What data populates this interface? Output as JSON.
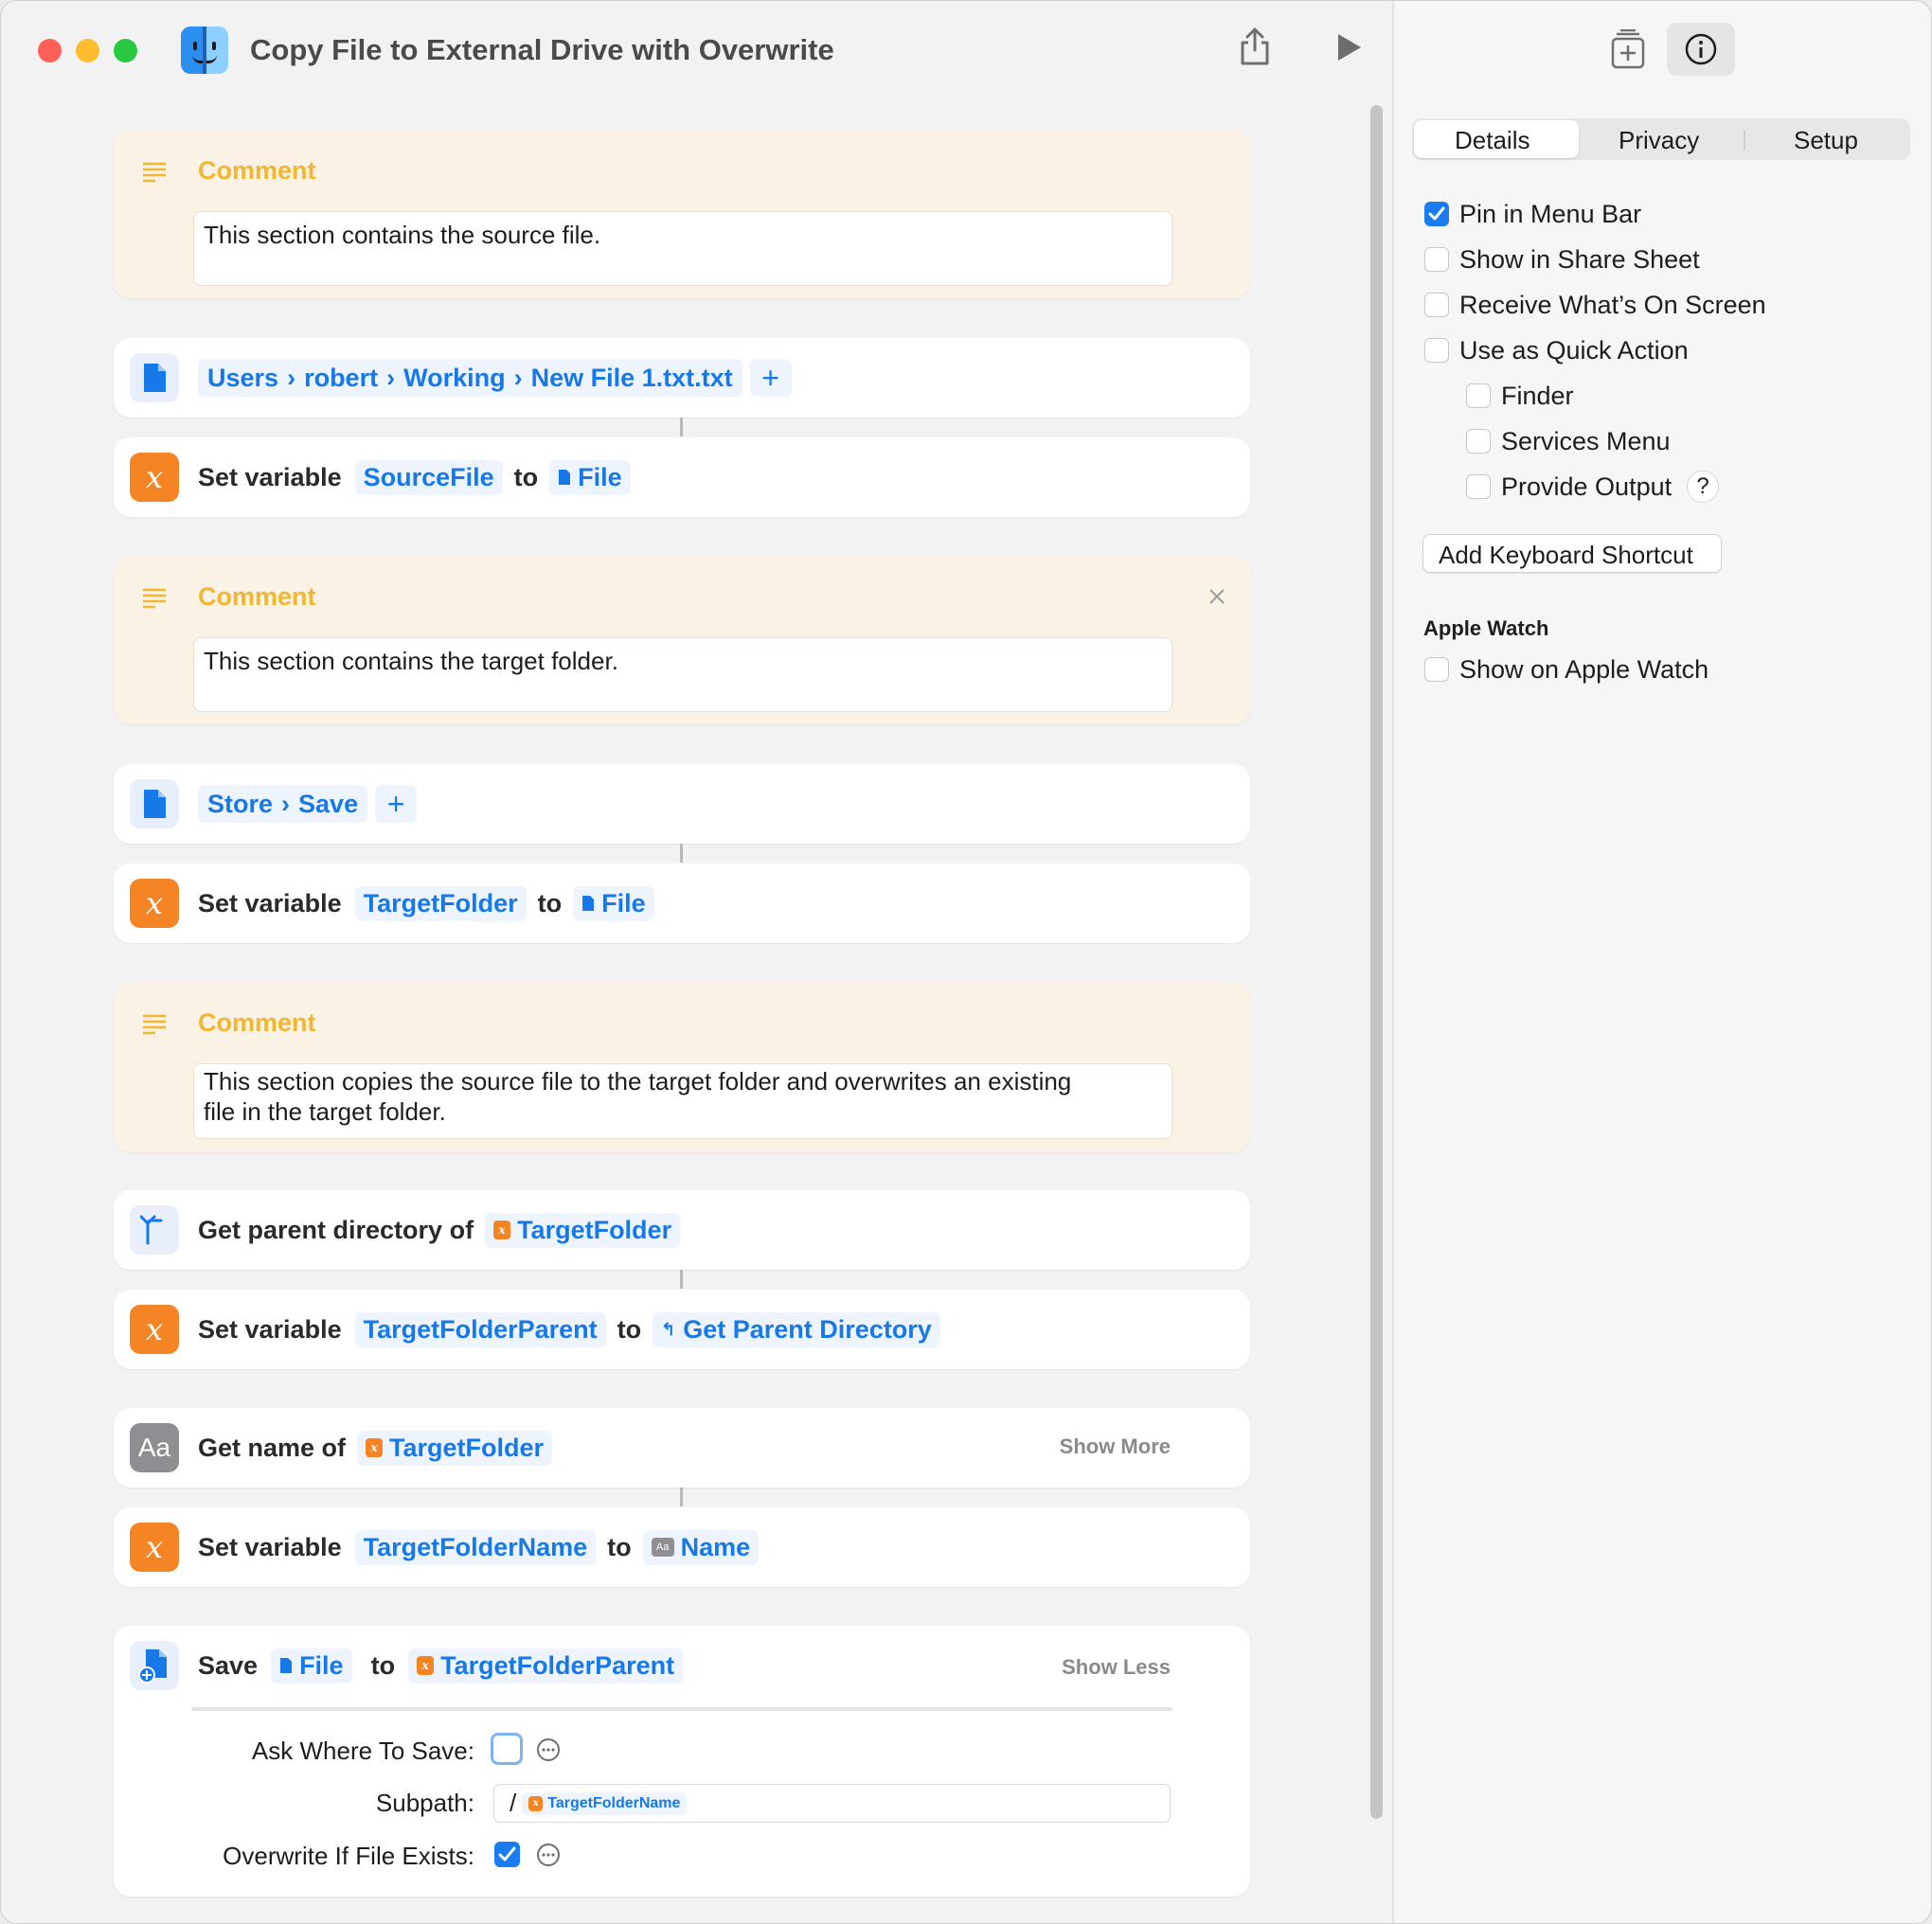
{
  "window": {
    "title": "Copy File to External Drive with Overwrite",
    "traffic_lights": {
      "close": "#fe5f57",
      "minimize": "#febc2e",
      "zoom": "#28c840"
    }
  },
  "actions": {
    "comment1": {
      "header": "Comment",
      "text": "This section contains the source file."
    },
    "file1": {
      "path": [
        "Users",
        "robert",
        "Working",
        "New File 1.txt.txt"
      ]
    },
    "setvar1": {
      "label": "Set variable",
      "var": "SourceFile",
      "to": "to",
      "value": "File"
    },
    "comment2": {
      "header": "Comment",
      "text": "This section contains the target folder."
    },
    "file2": {
      "path": [
        "Store",
        "Save"
      ]
    },
    "setvar2": {
      "label": "Set variable",
      "var": "TargetFolder",
      "to": "to",
      "value": "File"
    },
    "comment3": {
      "header": "Comment",
      "text_line1": "This section copies the source file to the target folder and overwrites an existing",
      "text_line2": "file in the target folder."
    },
    "getparent": {
      "label": "Get parent directory of",
      "input": "TargetFolder"
    },
    "setvar3": {
      "label": "Set variable",
      "var": "TargetFolderParent",
      "to": "to",
      "value": "Get Parent Directory"
    },
    "getname": {
      "label": "Get name of",
      "input": "TargetFolder",
      "show_more": "Show More",
      "icon_text": "Aa"
    },
    "setvar4": {
      "label": "Set variable",
      "var": "TargetFolderName",
      "to": "to",
      "value": "Name"
    },
    "save": {
      "label": "Save",
      "file": "File",
      "to": "to",
      "dest": "TargetFolderParent",
      "show_less": "Show Less",
      "ask_label": "Ask Where To Save:",
      "ask_checked": false,
      "subpath_label": "Subpath:",
      "subpath_prefix": "/",
      "subpath_var": "TargetFolderName",
      "overwrite_label": "Overwrite If File Exists:",
      "overwrite_checked": true
    }
  },
  "sidebar": {
    "tabs": [
      "Details",
      "Privacy",
      "Setup"
    ],
    "selected_tab": "Details",
    "options": [
      {
        "label": "Pin in Menu Bar",
        "checked": true
      },
      {
        "label": "Show in Share Sheet",
        "checked": false
      },
      {
        "label": "Receive What’s On Screen",
        "checked": false
      },
      {
        "label": "Use as Quick Action",
        "checked": false
      },
      {
        "label": "Finder",
        "checked": false
      },
      {
        "label": "Services Menu",
        "checked": false
      },
      {
        "label": "Provide Output",
        "checked": false
      }
    ],
    "help": "?",
    "keyboard_button": "Add Keyboard Shortcut",
    "watch_section": "Apple Watch",
    "watch_option": {
      "label": "Show on Apple Watch",
      "checked": false
    }
  },
  "colors": {
    "accent": "#1779e8",
    "comment_bg": "#faf2e4",
    "comment_header": "#f3b631",
    "variable_orange": "#f58424"
  },
  "icons": [
    "finder-icon",
    "share-icon",
    "play-icon",
    "add-to-library-icon",
    "info-icon",
    "comment-lines-icon",
    "document-icon",
    "variable-x-icon",
    "parent-directory-icon",
    "text-aa-icon",
    "save-document-icon",
    "close-icon",
    "ellipsis-circle-icon",
    "plus-icon",
    "chevron-right-icon"
  ]
}
